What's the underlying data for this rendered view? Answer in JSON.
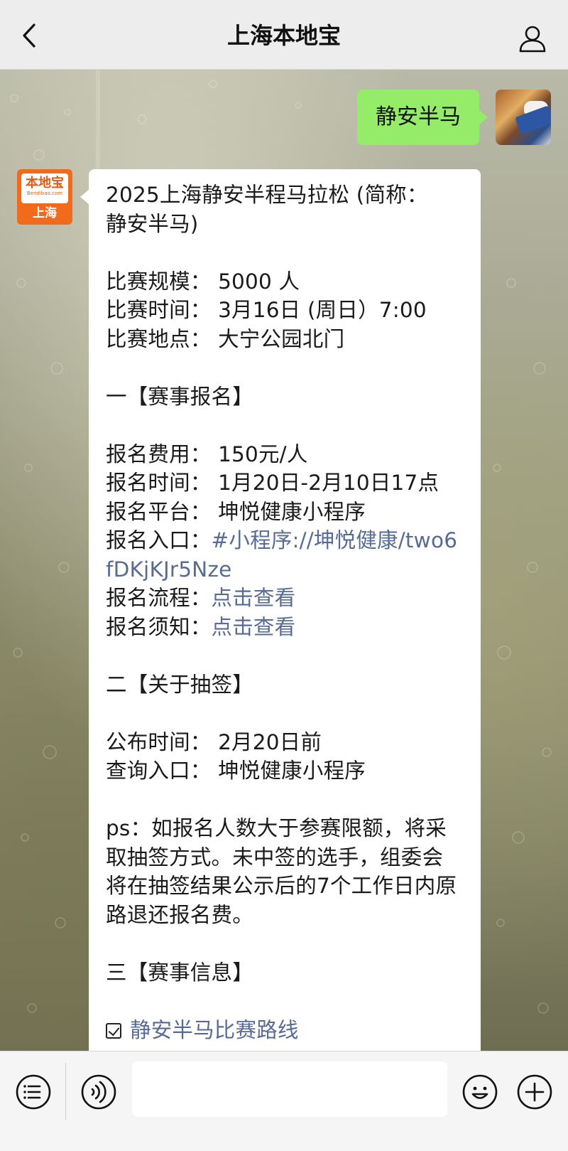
{
  "nav": {
    "title": "上海本地宝"
  },
  "sent_message": {
    "text": "静安半马"
  },
  "official_avatar": {
    "logo_top": "本地宝",
    "logo_url": "Bendibao.com",
    "logo_bottom": "上海"
  },
  "reply": {
    "title_line1": "2025上海静安半程马拉松 (简称：",
    "title_line2": "静安半马)",
    "scale": "比赛规模：  5000 人",
    "time": "比赛时间：  3月16日 (周日）7:00",
    "place": "比赛地点：  大宁公园北门",
    "section1": "一【赛事报名】",
    "fee": "报名费用：  150元/人",
    "signup_time": "报名时间：  1月20日-2月10日17点",
    "platform": "报名平台：  坤悦健康小程序",
    "entry_label": "报名入口：",
    "entry_link": "#小程序://坤悦健康/two6fDKjKJr5Nze",
    "process_label": "报名流程：",
    "process_link": "点击查看",
    "notice_label": "报名须知：",
    "notice_link": "点击查看",
    "section2": "二【关于抽签】",
    "announce": "公布时间：  2月20日前",
    "query": "查询入口：  坤悦健康小程序",
    "ps": "ps：如报名人数大于参赛限额，将采取抽签方式。未中签的选手，组委会将在抽签结果公示后的7个工作日内原路退还报名费。",
    "section3": "三【赛事信息】",
    "route_link": "静安半马比赛路线"
  },
  "colors": {
    "sent_bubble": "#95ec69",
    "link": "#576b95",
    "brand_orange": "#f26b1d"
  },
  "icons": {
    "back": "chevron-left-icon",
    "profile": "person-icon",
    "menu": "menu-list-icon",
    "voice": "voice-icon",
    "emoji": "emoji-icon",
    "plus": "plus-icon",
    "check": "checkbox-icon"
  }
}
